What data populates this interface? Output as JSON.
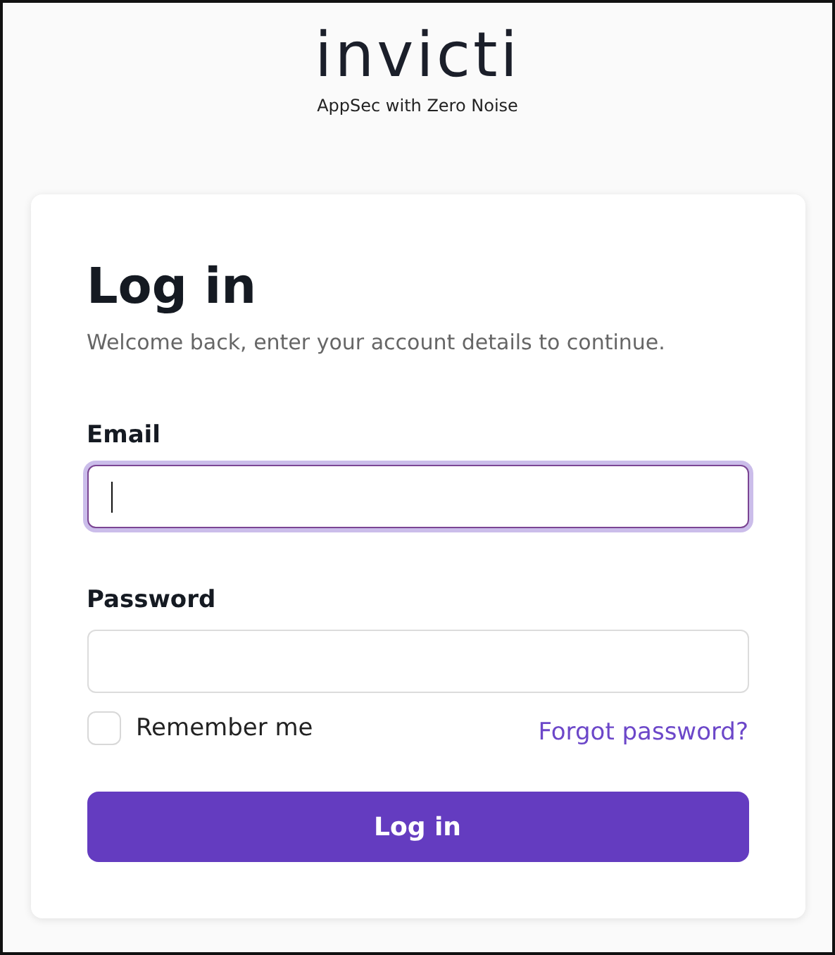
{
  "logo": {
    "wordmark": "invicti",
    "tagline": "AppSec with Zero Noise"
  },
  "title": "Log in",
  "subtitle": "Welcome back, enter your account details to continue.",
  "fields": [
    {
      "label": "Email",
      "focused": true
    },
    {
      "label": "Password",
      "focused": false
    }
  ],
  "remember": {
    "label": "Remember me",
    "checked": false
  },
  "forgot_link": "Forgot password?",
  "submit": "Log in"
}
